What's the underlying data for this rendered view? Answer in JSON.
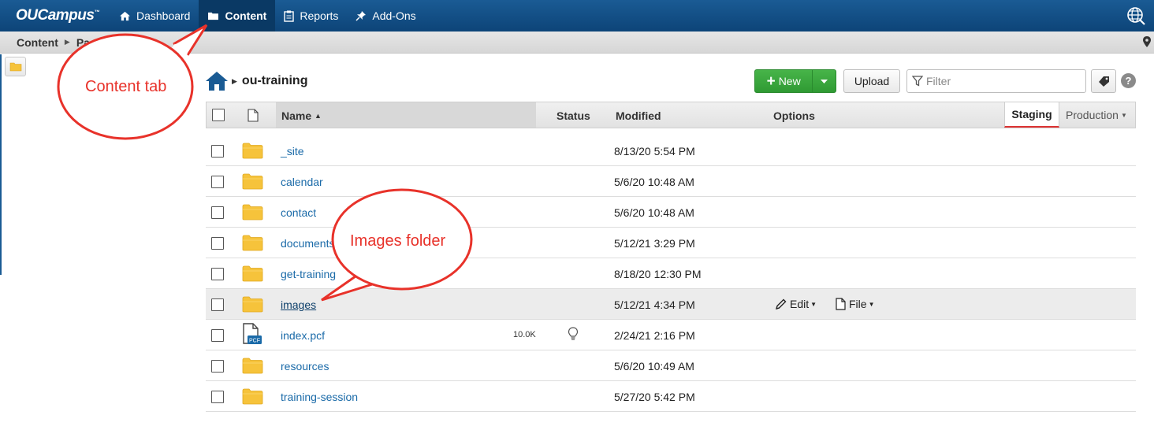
{
  "nav": {
    "logo": "OUCampus",
    "items": [
      {
        "label": "Dashboard",
        "icon": "home-icon"
      },
      {
        "label": "Content",
        "icon": "folder-icon",
        "active": true
      },
      {
        "label": "Reports",
        "icon": "clipboard-icon"
      },
      {
        "label": "Add-Ons",
        "icon": "pushpin-icon"
      }
    ]
  },
  "breadcrumb": {
    "root": "Content",
    "next": "Pa"
  },
  "toolbar": {
    "path_title": "ou-training",
    "new_label": "New",
    "upload_label": "Upload",
    "filter_placeholder": "Filter",
    "help": "?"
  },
  "table": {
    "headers": {
      "name": "Name",
      "status": "Status",
      "modified": "Modified",
      "options": "Options"
    },
    "server_tabs": {
      "staging": "Staging",
      "production": "Production"
    },
    "rows": [
      {
        "name": "_site",
        "type": "folder",
        "modified": "8/13/20 5:54 PM"
      },
      {
        "name": "calendar",
        "type": "folder",
        "modified": "5/6/20 10:48 AM"
      },
      {
        "name": "contact",
        "type": "folder",
        "modified": "5/6/20 10:48 AM"
      },
      {
        "name": "documents",
        "type": "folder",
        "modified": "5/12/21 3:29 PM"
      },
      {
        "name": "get-training",
        "type": "folder",
        "modified": "8/18/20 12:30 PM"
      },
      {
        "name": "images",
        "type": "folder",
        "modified": "5/12/21 4:34 PM",
        "highlighted": true,
        "options": {
          "edit": "Edit",
          "file": "File"
        }
      },
      {
        "name": "index.pcf",
        "type": "pcf",
        "size": "10.0K",
        "status_icon": "lightbulb-icon",
        "modified": "2/24/21 2:16 PM",
        "file_badge": "PCF"
      },
      {
        "name": "resources",
        "type": "folder",
        "modified": "5/6/20 10:49 AM"
      },
      {
        "name": "training-session",
        "type": "folder",
        "modified": "5/27/20 5:42 PM"
      }
    ]
  },
  "annotations": {
    "content_tab": "Content tab",
    "images_folder": "Images folder"
  },
  "colors": {
    "nav": "#0d4478",
    "link": "#1a6aa8",
    "new_button": "#3aa83d",
    "callout": "#e8322a",
    "folder": "#f6c33b"
  }
}
